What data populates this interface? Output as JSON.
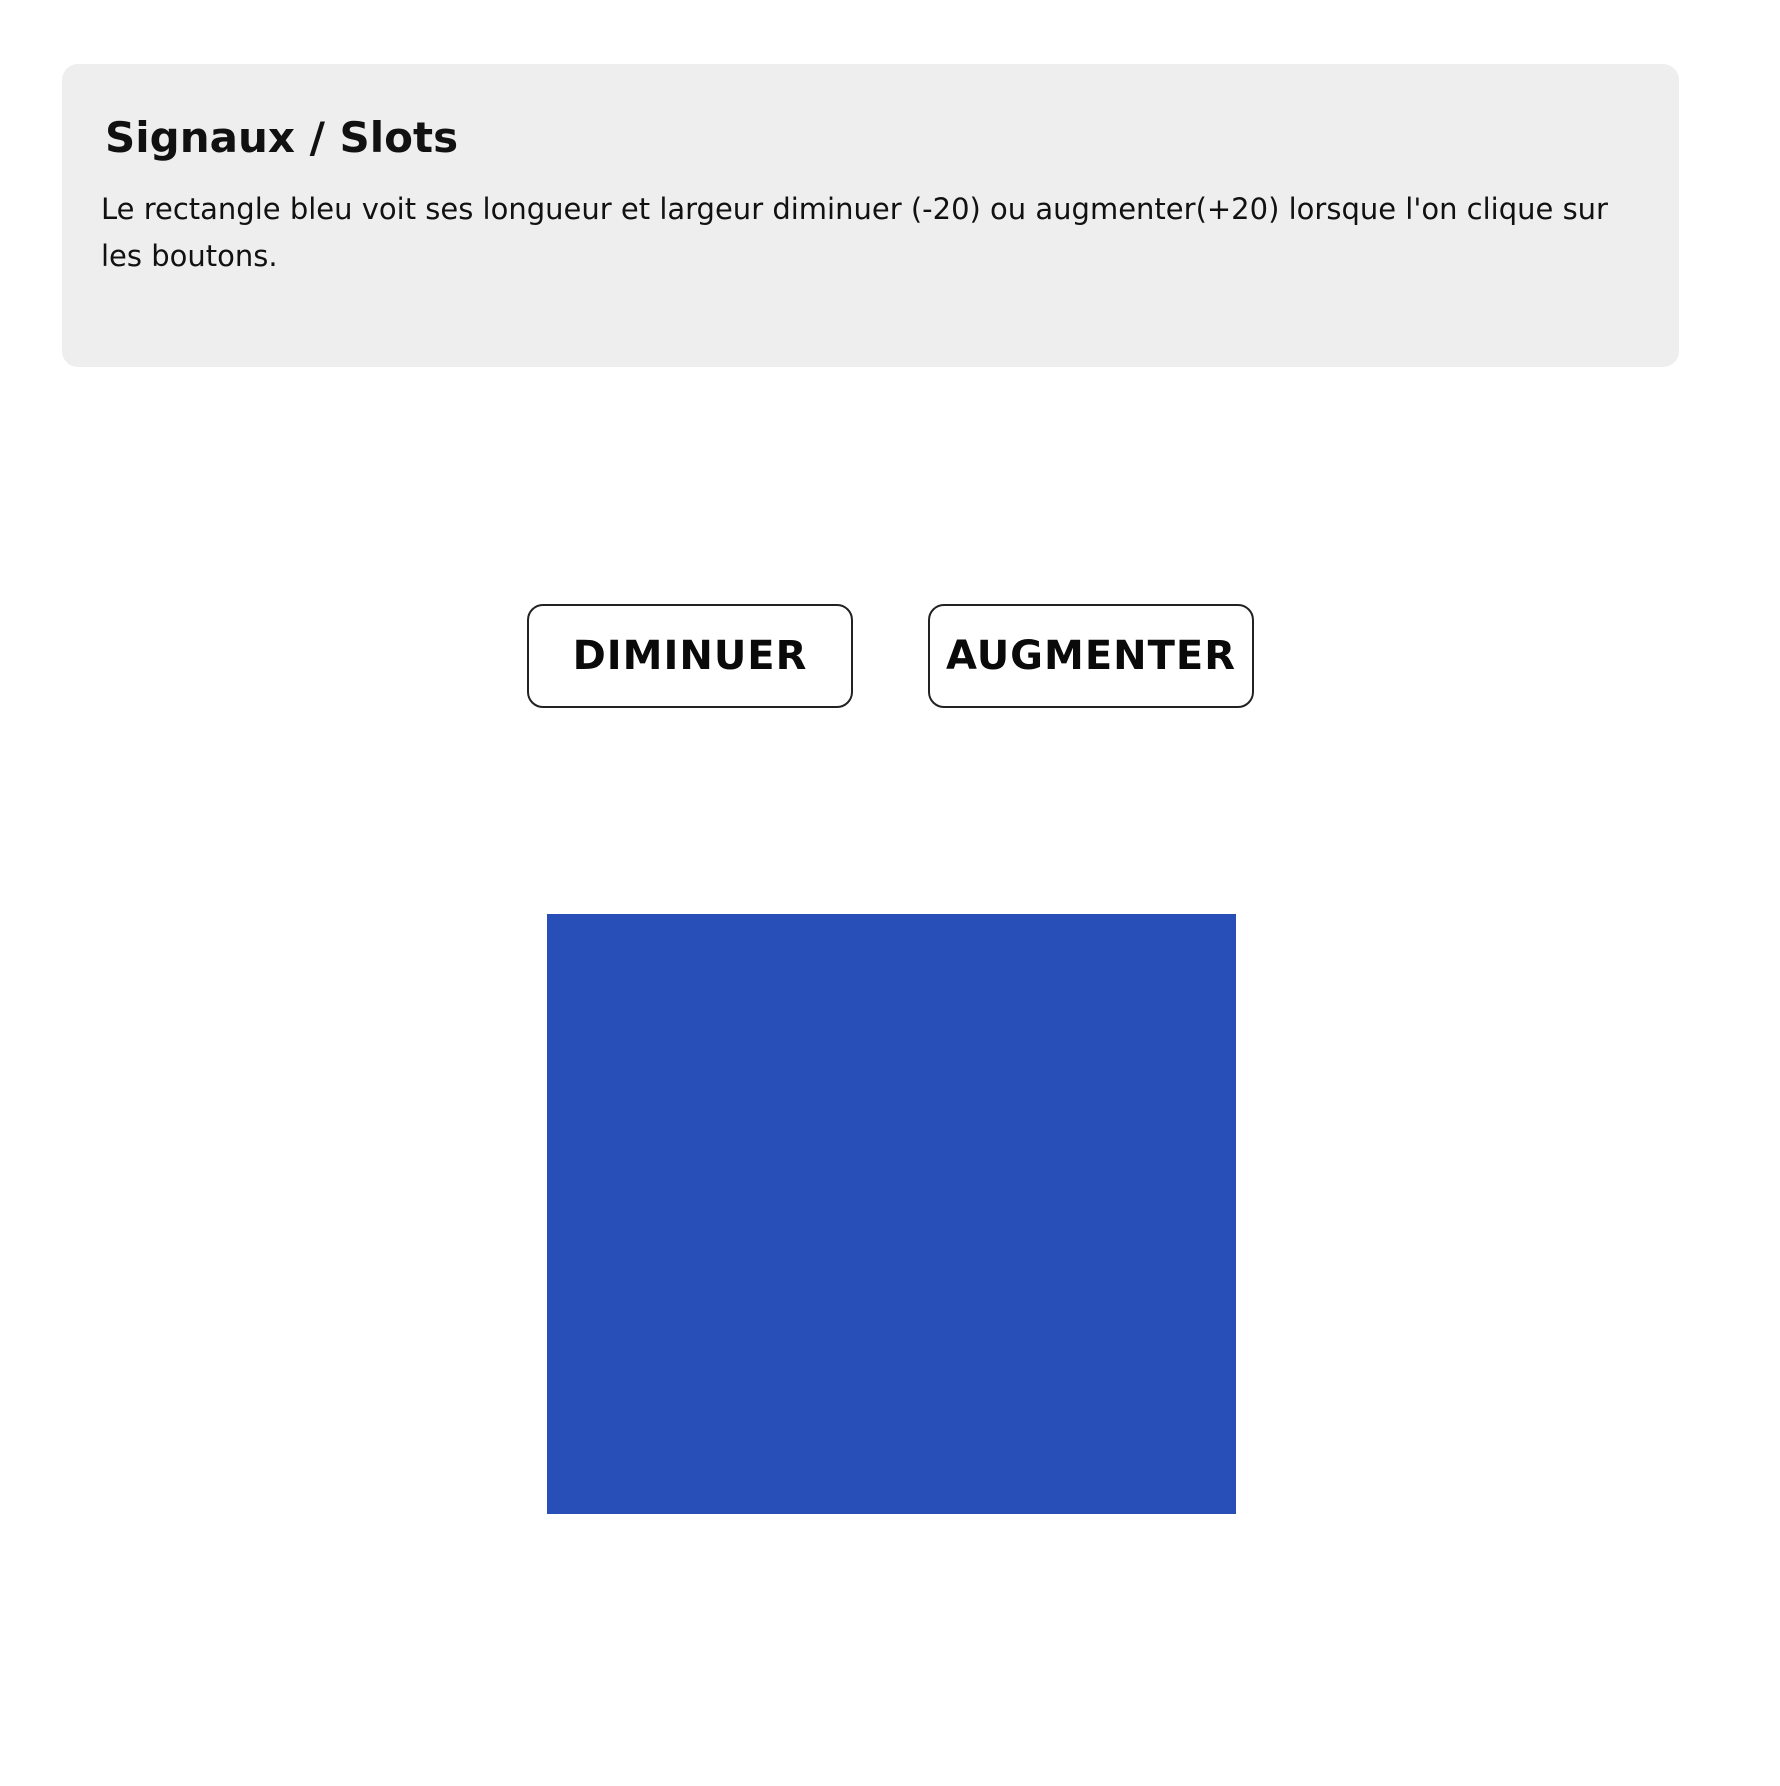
{
  "panel": {
    "title": "Signaux / Slots",
    "description": "Le rectangle bleu voit ses longueur et largeur diminuer (-20) ou augmenter(+20) lorsque l'on clique sur les boutons."
  },
  "controls": {
    "decrease_label": "DIMINUER",
    "increase_label": "AUGMENTER"
  },
  "colors": {
    "panel_background": "#eeeeee",
    "rectangle": "#284fb8",
    "button_border": "#222222",
    "text": "#111111"
  }
}
